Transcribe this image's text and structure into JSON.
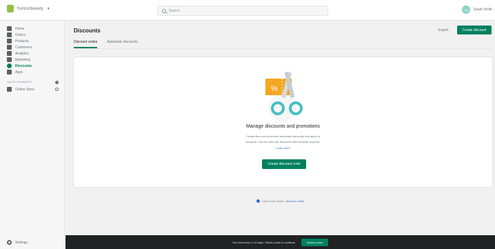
{
  "topbar": {
    "store_name": "horizonbeauty",
    "search_placeholder": "Search",
    "user_name": "Sarah Smith",
    "avatar_initials": "SS"
  },
  "sidebar": {
    "items": [
      {
        "label": "Home"
      },
      {
        "label": "Orders"
      },
      {
        "label": "Products"
      },
      {
        "label": "Customers"
      },
      {
        "label": "Analytics"
      },
      {
        "label": "Marketing"
      },
      {
        "label": "Discounts"
      },
      {
        "label": "Apps"
      }
    ],
    "sales_channels_label": "SALES CHANNELS",
    "online_store_label": "Online Store",
    "settings_label": "Settings"
  },
  "page": {
    "title": "Discounts",
    "export_label": "Export",
    "create_label": "Create discount",
    "tabs": [
      {
        "label": "Discount codes"
      },
      {
        "label": "Automatic discounts"
      }
    ]
  },
  "card": {
    "title": "Manage discounts and promotions",
    "desc_line1": "Create discount codes and automatic discounts that apply at",
    "desc_line2": "checkout. You can also use discounts with compare at prices.",
    "learn_link": "Learn more",
    "create_label": "Create discount code"
  },
  "help": {
    "text": "Learn more about",
    "link": "discount codes"
  },
  "bottombar": {
    "text": "Your trial ends in 14 days. Select a plan to continue.",
    "plan_label": "Select a plan"
  },
  "colors": {
    "accent": "#008060",
    "link": "#2c6ecb",
    "illustration_orange": "#f5a623",
    "illustration_teal": "#47c1bf"
  }
}
